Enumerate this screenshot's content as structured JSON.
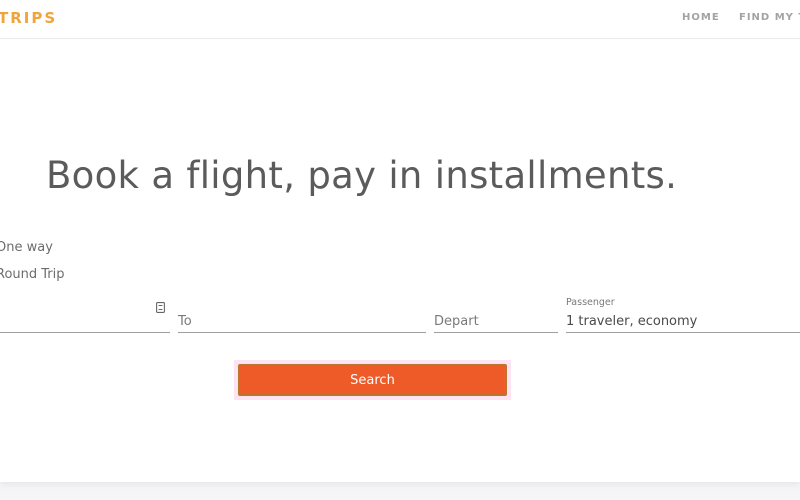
{
  "brand": {
    "logo_text": "TRIPS",
    "accent_color": "#f2a33a"
  },
  "nav": {
    "items": [
      {
        "label": "HOME"
      },
      {
        "label": "FIND MY TRIP"
      }
    ]
  },
  "hero": {
    "headline": "Book a flight, pay in installments."
  },
  "trip_type": {
    "options": [
      {
        "label": "One way"
      },
      {
        "label": "Round Trip"
      }
    ]
  },
  "search_form": {
    "from": {
      "placeholder": "",
      "icon": "swap-icon"
    },
    "to": {
      "placeholder": "To"
    },
    "depart": {
      "placeholder": "Depart"
    },
    "passenger": {
      "label": "Passenger",
      "value": "1 traveler, economy",
      "icon": "chevron-down-icon"
    },
    "submit_label": "Search",
    "submit_color": "#ee5a28"
  }
}
